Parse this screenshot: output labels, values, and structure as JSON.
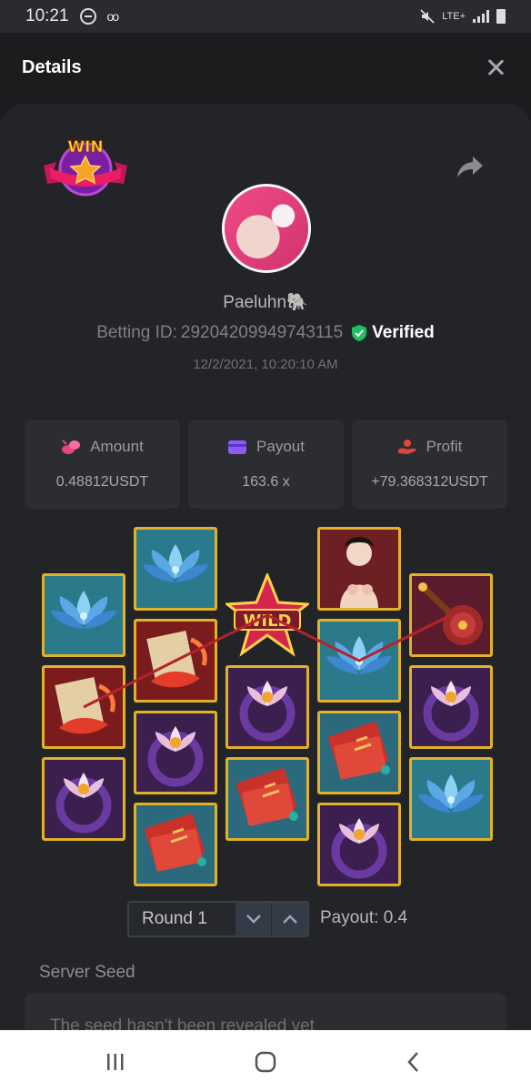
{
  "status_bar": {
    "time": "10:21",
    "network": "LTE+"
  },
  "header": {
    "title": "Details"
  },
  "profile": {
    "username": "Paeluhn🐘",
    "betting_id_label": "Betting ID:",
    "betting_id": "29204209949743115",
    "verified_label": "Verified",
    "datetime": "12/2/2021, 10:20:10 AM",
    "badge_text": "WIN"
  },
  "stats": [
    {
      "label": "Amount",
      "value": "0.48812USDT",
      "icon": "coins-icon",
      "color": "#e8457e"
    },
    {
      "label": "Payout",
      "value": "163.6 x",
      "icon": "wallet-icon",
      "color": "#8b5cf6"
    },
    {
      "label": "Profit",
      "value": "+79.368312USDT",
      "icon": "profit-hand-icon",
      "color": "#e0463a"
    }
  ],
  "reels": {
    "wild_text": "WILD",
    "columns": [
      [
        "blue-lotus",
        "scroll-fish",
        "lotus-ring"
      ],
      [
        "blue-lotus",
        "scroll-fish",
        "lotus-ring",
        "red-book"
      ],
      [
        "wild",
        "lotus-ring",
        "red-book"
      ],
      [
        "geisha",
        "blue-lotus",
        "red-book",
        "lotus-ring"
      ],
      [
        "lute",
        "lotus-ring",
        "blue-lotus"
      ]
    ],
    "payline_color": "#b3242a"
  },
  "round": {
    "label": "Round 1",
    "payout_label": "Payout: 0.4"
  },
  "server_seed": {
    "label": "Server Seed",
    "value": "The seed hasn't been revealed yet"
  }
}
